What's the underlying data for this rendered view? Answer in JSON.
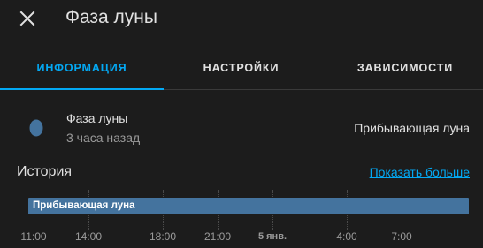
{
  "dialog": {
    "title": "Фаза луны"
  },
  "tabs": [
    {
      "label": "ИНФОРМАЦИЯ",
      "active": true
    },
    {
      "label": "НАСТРОЙКИ",
      "active": false
    },
    {
      "label": "ЗАВИСИМОСТИ",
      "active": false
    }
  ],
  "entity": {
    "name": "Фаза луны",
    "last_changed": "3 часа назад",
    "state": "Прибывающая луна",
    "icon": "moon-waxing-crescent-icon",
    "icon_color": "#44739e"
  },
  "history": {
    "title": "История",
    "show_more": "Показать больше",
    "bar_label": "Прибывающая луна",
    "bar_color": "#44739e",
    "ticks": [
      {
        "label": "11:00",
        "major": false
      },
      {
        "label": "14:00",
        "major": false
      },
      {
        "label": "18:00",
        "major": false
      },
      {
        "label": "21:00",
        "major": false
      },
      {
        "label": "5 янв.",
        "major": true
      },
      {
        "label": "4:00",
        "major": false
      },
      {
        "label": "7:00",
        "major": false
      }
    ]
  },
  "colors": {
    "accent": "#03a9f4",
    "background": "#1c1c1c"
  }
}
